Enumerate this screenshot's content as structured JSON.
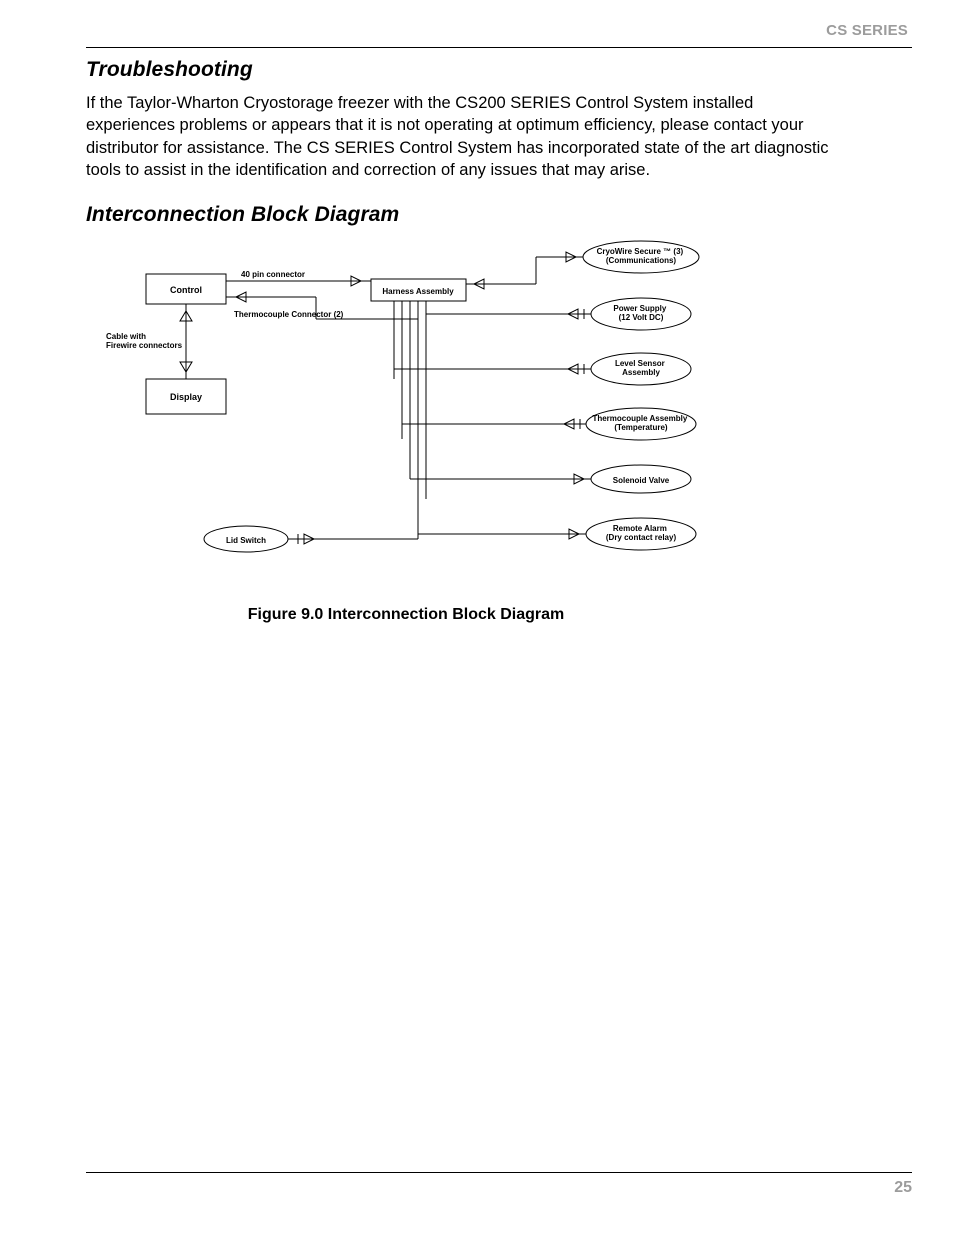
{
  "header": {
    "brand": "CS SERIES"
  },
  "troubleshooting": {
    "heading": "Troubleshooting",
    "body": "If the Taylor-Wharton Cryostorage freezer with the CS200 SERIES Control System installed experiences problems or appears that it is not operating at optimum efficiency, please contact your distributor for assistance. The CS SERIES Control System has incorporated state of the art diagnostic tools to assist in the identification and correction of any issues that may arise."
  },
  "diagram": {
    "heading": "Interconnection Block Diagram",
    "caption": "Figure 9.0 Interconnection Block Diagram",
    "nodes": {
      "control": "Control",
      "display": "Display",
      "harness": "Harness Assembly",
      "lid_switch": "Lid Switch",
      "cryowire": "CryoWire Secure ™ (3) (Communications)",
      "power": "Power Supply (12 Volt DC)",
      "level": "Level Sensor Assembly",
      "thermo_assy": "Thermocouple Assembly (Temperature)",
      "solenoid": "Solenoid Valve",
      "remote": "Remote Alarm (Dry contact relay)"
    },
    "edge_labels": {
      "pin40": "40 pin connector",
      "thermo_conn": "Thermocouple Connector (2)",
      "cable_firewire": "Cable with Firewire connectors"
    }
  },
  "page_number": "25"
}
